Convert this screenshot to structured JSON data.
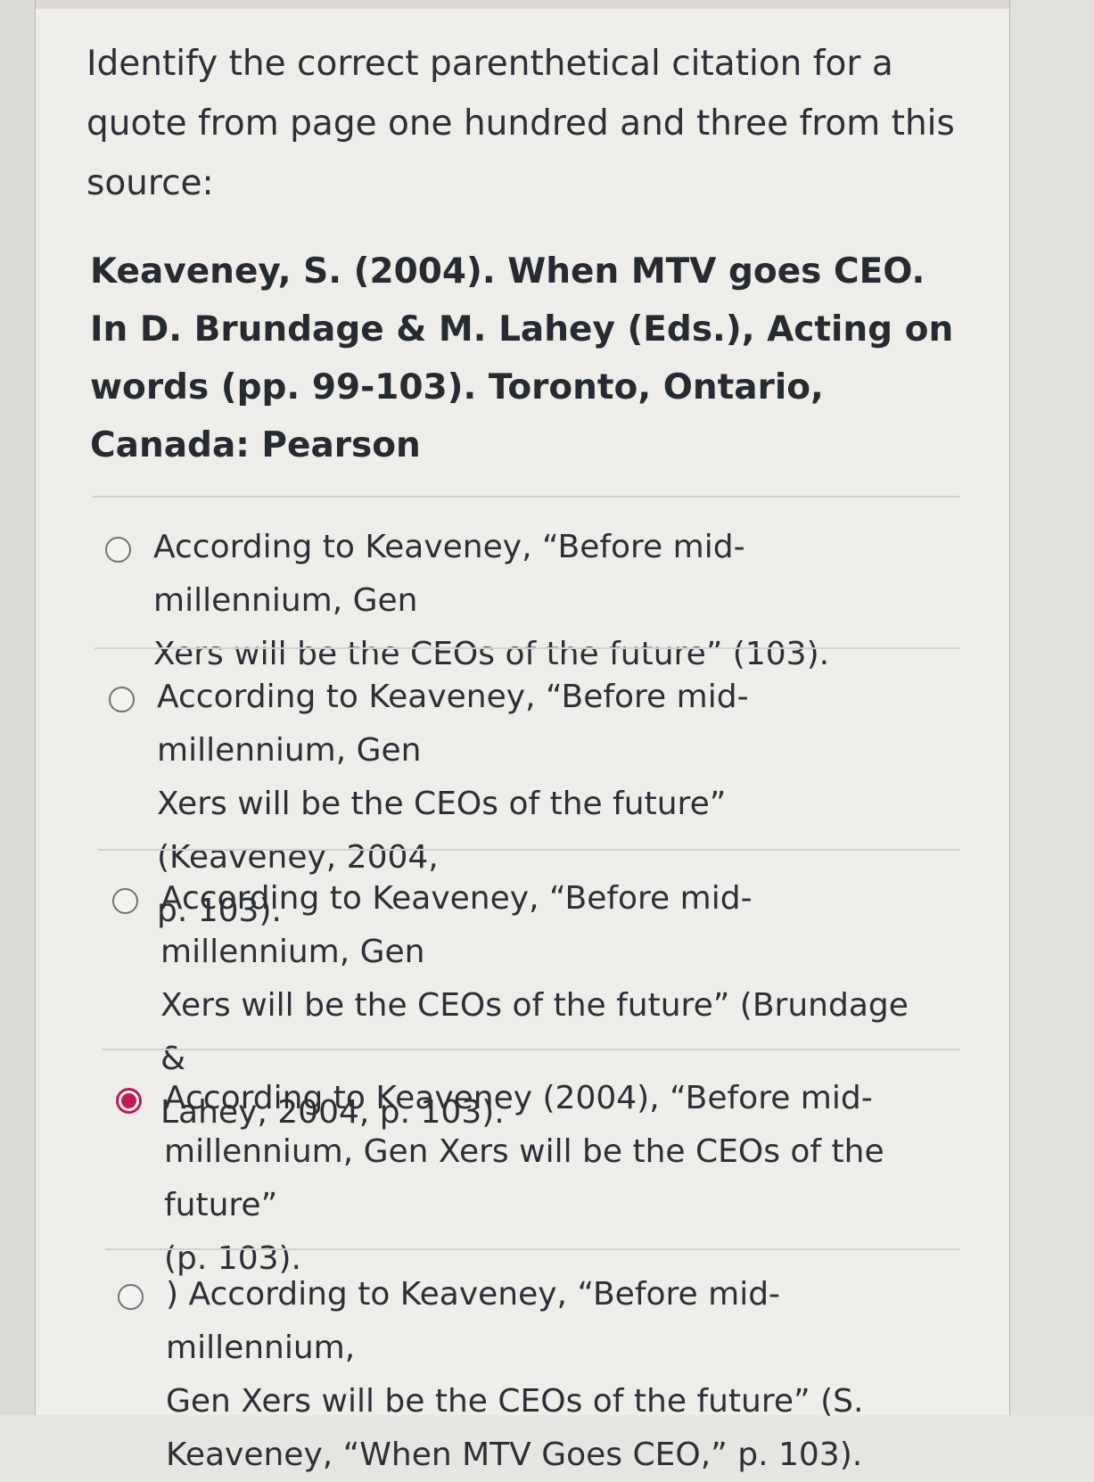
{
  "question": {
    "prompt": "Identify the correct parenthetical citation for a quote from page one hundred and three from this source:",
    "reference": "Keaveney, S. (2004). When MTV goes CEO. In D. Brundage & M. Lahey (Eds.), Acting on words (pp. 99-103). Toronto, Ontario, Canada: Pearson"
  },
  "answers": [
    {
      "text": "According to Keaveney, “Before mid-millennium, Gen\nXers will be the CEOs of the future” (103).",
      "selected": false
    },
    {
      "text": "According to Keaveney, “Before mid-millennium, Gen\nXers will be the CEOs of the future” (Keaveney, 2004,\np. 103).",
      "selected": false
    },
    {
      "text": "According to Keaveney, “Before mid-millennium, Gen\nXers will be the CEOs of the future” (Brundage &\nLahey, 2004, p. 103).",
      "selected": false
    },
    {
      "text": "According to Keaveney (2004), “Before mid-\nmillennium, Gen Xers will be the CEOs of the future”\n(p. 103).",
      "selected": true
    },
    {
      "text": ") According to Keaveney, “Before mid-millennium,\nGen Xers will be the CEOs of the future” (S.\nKeaveney, “When MTV Goes CEO,” p. 103).",
      "selected": false
    }
  ],
  "colors": {
    "selected_radio": "#c21a55",
    "text": "#2b3036",
    "background": "#eeedea"
  }
}
